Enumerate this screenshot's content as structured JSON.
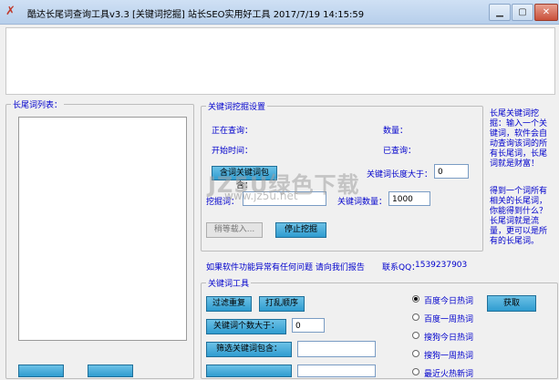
{
  "window": {
    "title": "酷达长尾词查询工具v3.3  [关键词挖掘]  站长SEO实用好工具  2017/7/19 14:15:59",
    "min_glyph": "▁",
    "max_glyph": "▢",
    "close_glyph": "✕"
  },
  "longtail_list": {
    "label": "长尾词列表："
  },
  "mining": {
    "group_label": "关键词挖掘设置",
    "querying_label": "正在查询：",
    "count_label": "数量：",
    "start_time_label": "开始时间：",
    "queried_label": "已查询：",
    "contains_label": "含词关键词包含：",
    "length_label": "关键词长度大于：",
    "length_value": "0",
    "seed_label": "挖掘词：",
    "max_count_label": "关键词数量：",
    "max_count_value": "1000",
    "wait_button": "稍等载入...",
    "stop_button": "停止挖掘"
  },
  "side_info": {
    "text1": "长尾关键词挖掘：输入一个关键词，软件会自动查询该词的所有长尾词，长尾词就是财富！",
    "text2": "得到一个词所有相关的长尾词，你能得到什么？长尾词就是流量，更可以是所有的长尾词。"
  },
  "report": {
    "text": "如果软件功能异常有任何问题 请向我们报告",
    "qq_label": "联系QQ：",
    "qq_value": "1539237903"
  },
  "tools": {
    "group_label": "关键词工具",
    "filter_dup_button": "过滤重复",
    "shuffle_button": "打乱顺序",
    "count_gt_button": "关键词个数大于：",
    "count_gt_value": "0",
    "filter_contains_button": "筛选关键词包含：",
    "fetch_button": "获取",
    "radios": [
      {
        "label": "百度今日热词",
        "selected": true
      },
      {
        "label": "百度一周热词",
        "selected": false
      },
      {
        "label": "搜狗今日热词",
        "selected": false
      },
      {
        "label": "搜狗一周热词",
        "selected": false
      },
      {
        "label": "最近火热新词",
        "selected": false
      }
    ]
  },
  "watermark": {
    "text": "JZ5U绿色下载",
    "sub": "www.jz5u.net"
  }
}
